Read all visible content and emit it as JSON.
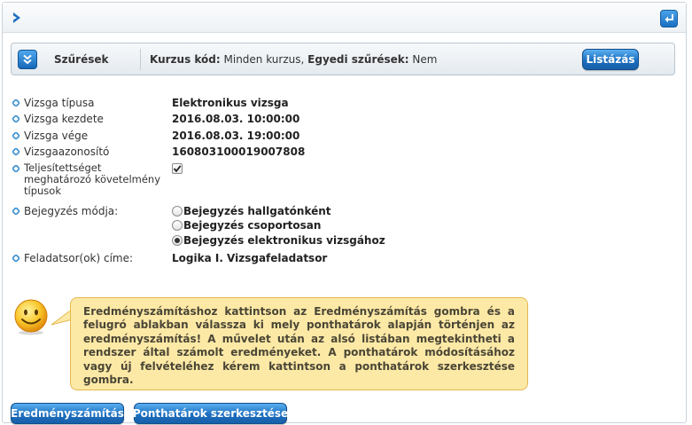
{
  "filter": {
    "title": "Szűrések",
    "course_code_label": "Kurzus kód:",
    "course_code_value": "Minden kurzus,",
    "custom_filters_label": "Egyedi szűrések:",
    "custom_filters_value": "Nem",
    "list_button": "Listázás"
  },
  "details": {
    "exam_type_label": "Vizsga típusa",
    "exam_type_value": "Elektronikus vizsga",
    "exam_start_label": "Vizsga kezdete",
    "exam_start_value": "2016.08.03. 10:00:00",
    "exam_end_label": "Vizsga vége",
    "exam_end_value": "2016.08.03. 19:00:00",
    "exam_id_label": "Vizsgaazonosító",
    "exam_id_value": "160803100019007808",
    "completion_label_line1": "Teljesítettséget",
    "completion_label_line2": "meghatározó követelmény",
    "completion_label_line3": "típusok",
    "completion_checked": true,
    "entry_mode_label": "Bejegyzés módja:",
    "entry_options": [
      {
        "label": "Bejegyzés hallgatónként",
        "selected": false
      },
      {
        "label": "Bejegyzés csoportosan",
        "selected": false
      },
      {
        "label": "Bejegyzés elektronikus vizsgához",
        "selected": true
      }
    ],
    "task_sheet_label": "Feladatsor(ok) címe:",
    "task_sheet_value": "Logika I. Vizsgafeladatsor"
  },
  "help": {
    "text": "Eredményszámításhoz kattintson az Eredményszámítás gombra és a felugró ablakban válassza ki mely ponthatárok alapján történjen az eredményszámítás! A művelet után az alsó listában megtekintheti a rendszer által számolt eredményeket. A ponthatárok módosításához vagy új felvételéhez kérem kattintson a ponthatárok szerkesztése gombra."
  },
  "actions": {
    "calc_button": "Eredményszámítás",
    "edit_thresholds_button": "Ponthatárok szerkesztése"
  },
  "colors": {
    "accent_blue": "#1c6fc0",
    "bubble_bg": "#fde9a6",
    "bubble_border": "#e3b84f",
    "bullet": "#3a8fcf"
  },
  "icons": {
    "expand": "chevron-right-icon",
    "return": "return-arrow-icon",
    "filter_toggle": "double-chevron-down-icon",
    "bullet": "diamond-bullet-icon",
    "checkbox": "checkmark-icon",
    "mascot": "smiley-icon"
  }
}
